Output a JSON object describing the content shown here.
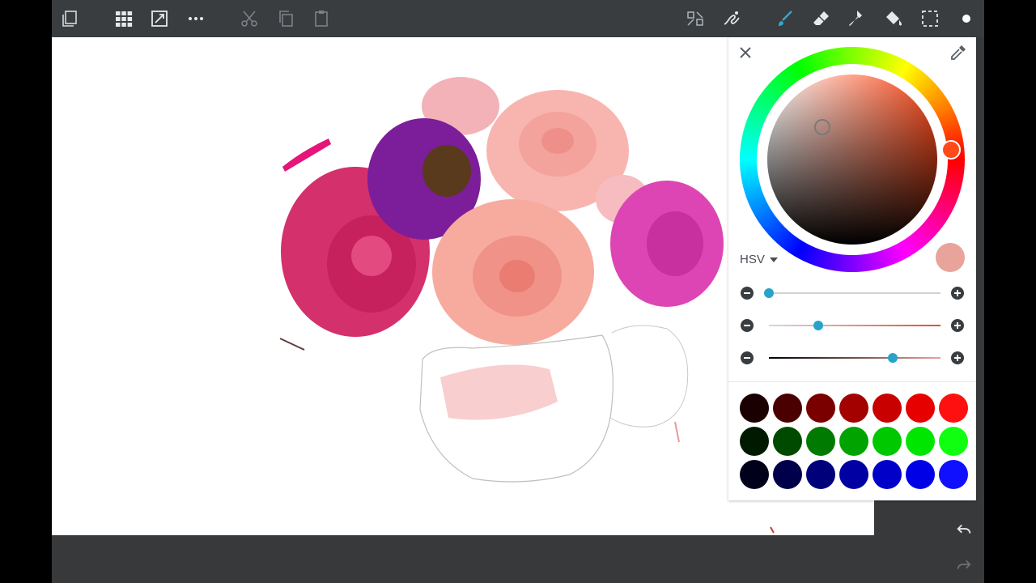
{
  "toolbar": {
    "left_icons": [
      "layers-icon",
      "grid-icon",
      "transform-icon",
      "more-icon",
      "cut-icon",
      "copy-icon",
      "paste-icon"
    ],
    "right_icons": [
      "symmetry-icon",
      "stroke-icon",
      "brush-icon",
      "eraser-icon",
      "smudge-icon",
      "fill-icon",
      "selection-icon",
      "color-dot-icon"
    ]
  },
  "color_panel": {
    "mode_label": "HSV",
    "current_color": "#e8a39b",
    "hue_color": "#ff4a1a",
    "sliders": [
      {
        "name": "hue",
        "value": 0.0
      },
      {
        "name": "saturation",
        "value": 0.29
      },
      {
        "name": "value",
        "value": 0.72
      }
    ],
    "palette": [
      [
        "#1a0000",
        "#4a0000",
        "#7a0000",
        "#a30000",
        "#c80000",
        "#e60000",
        "#ff1010"
      ],
      [
        "#001a00",
        "#004a00",
        "#007a00",
        "#00a300",
        "#00c800",
        "#00e600",
        "#10ff10"
      ],
      [
        "#00001a",
        "#00004a",
        "#00007a",
        "#0000a3",
        "#0000c8",
        "#0000e6",
        "#1010ff"
      ]
    ]
  }
}
